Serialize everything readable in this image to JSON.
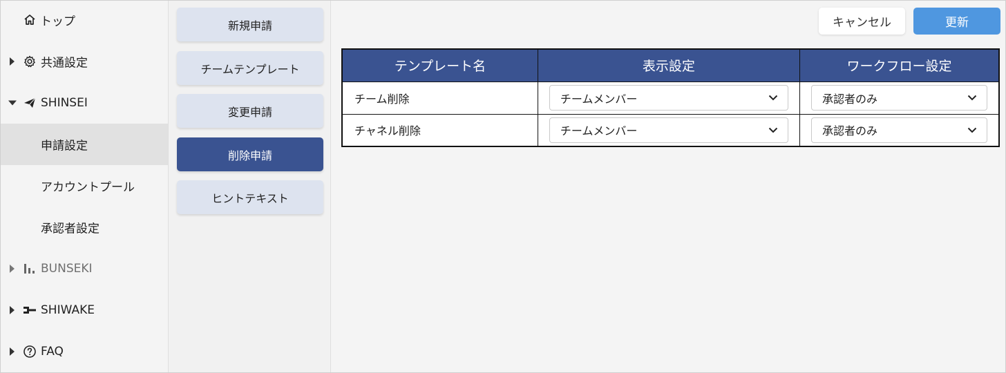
{
  "sidebar": {
    "items": [
      {
        "label": "トップ",
        "icon": "home-icon"
      },
      {
        "label": "共通設定",
        "icon": "gear-icon"
      },
      {
        "label": "SHINSEI",
        "icon": "paper-plane-icon"
      },
      {
        "label": "申請設定"
      },
      {
        "label": "アカウントプール"
      },
      {
        "label": "承認者設定"
      },
      {
        "label": "BUNSEKI",
        "icon": "bar-chart-icon"
      },
      {
        "label": "SHIWAKE",
        "icon": "sort-icon"
      },
      {
        "label": "FAQ",
        "icon": "question-circle-icon"
      }
    ]
  },
  "menu": {
    "items": [
      {
        "label": "新規申請"
      },
      {
        "label": "チームテンプレート"
      },
      {
        "label": "変更申請"
      },
      {
        "label": "削除申請"
      },
      {
        "label": "ヒントテキスト"
      }
    ],
    "active_index": 3
  },
  "toolbar": {
    "cancel_label": "キャンセル",
    "update_label": "更新"
  },
  "table": {
    "headers": [
      "テンプレート名",
      "表示設定",
      "ワークフロー設定"
    ],
    "rows": [
      {
        "name": "チーム削除",
        "display": "チームメンバー",
        "workflow": "承認者のみ"
      },
      {
        "name": "チャネル削除",
        "display": "チームメンバー",
        "workflow": "承認者のみ"
      }
    ]
  },
  "colors": {
    "primary": "#3a5391",
    "accent": "#4f97e0",
    "menu_button": "#dde3ef"
  }
}
